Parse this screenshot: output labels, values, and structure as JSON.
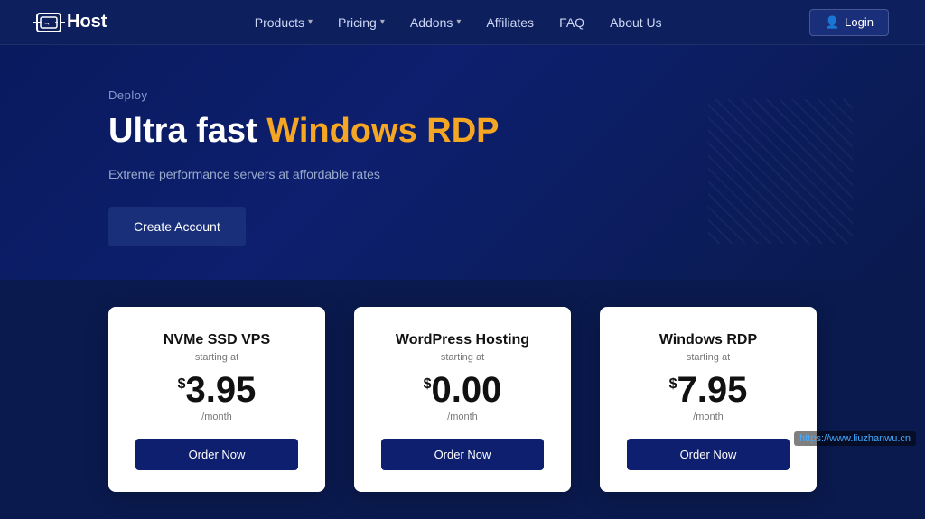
{
  "brand": {
    "name": "Host",
    "logo_arrow": "→"
  },
  "navbar": {
    "links": [
      {
        "label": "Products",
        "has_dropdown": true
      },
      {
        "label": "Pricing",
        "has_dropdown": true
      },
      {
        "label": "Addons",
        "has_dropdown": true
      },
      {
        "label": "Affiliates",
        "has_dropdown": false
      },
      {
        "label": "FAQ",
        "has_dropdown": false
      },
      {
        "label": "About Us",
        "has_dropdown": false
      }
    ],
    "login_label": "Login"
  },
  "hero": {
    "deploy_label": "Deploy",
    "title_prefix": "Ultra fast ",
    "title_highlight": "Windows RDP",
    "subtitle": "Extreme performance servers at affordable rates",
    "cta_label": "Create Account"
  },
  "cards": [
    {
      "title": "NVMe SSD VPS",
      "starting_label": "starting at",
      "dollar": "$",
      "price": "3.95",
      "period": "/month",
      "btn_label": "Order Now"
    },
    {
      "title": "WordPress Hosting",
      "starting_label": "starting at",
      "dollar": "$",
      "price": "0.00",
      "period": "/month",
      "btn_label": "Order Now"
    },
    {
      "title": "Windows RDP",
      "starting_label": "starting at",
      "dollar": "$",
      "price": "7.95",
      "period": "/month",
      "btn_label": "Order Now"
    }
  ],
  "watermark": "https://www.liuzhanwu.cn"
}
